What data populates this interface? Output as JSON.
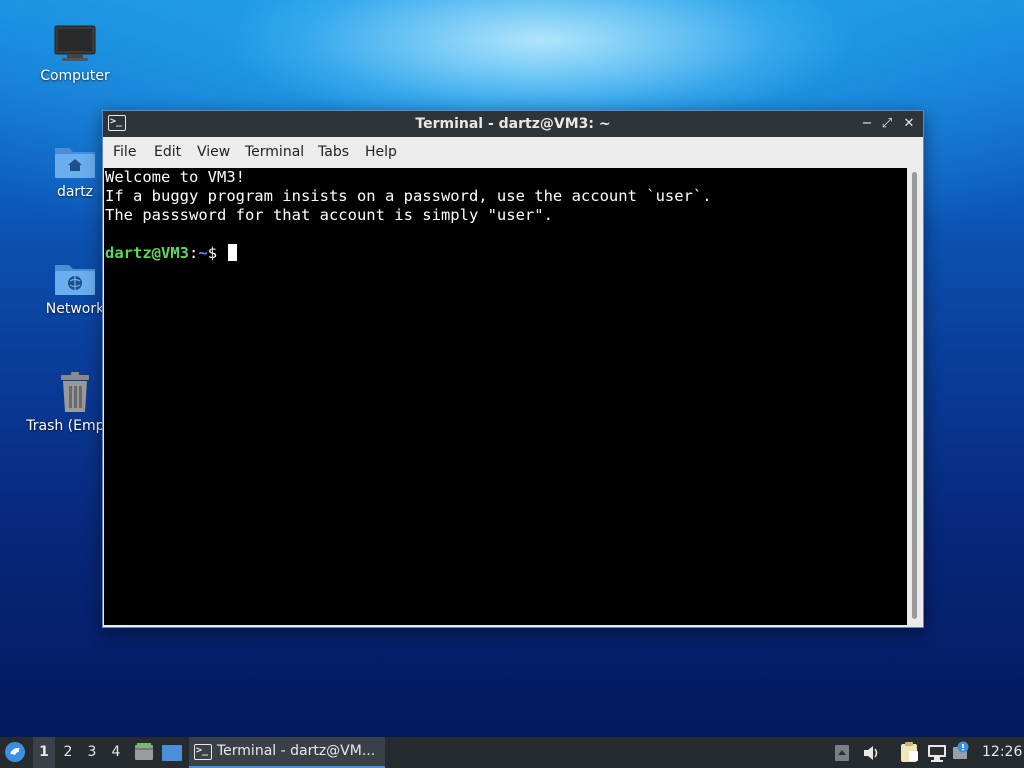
{
  "desktop": {
    "icons": [
      {
        "label": "Computer",
        "icon": "computer-icon"
      },
      {
        "label": "dartz",
        "icon": "home-folder-icon"
      },
      {
        "label": "Network",
        "icon": "network-folder-icon"
      },
      {
        "label": "Trash (Empty)",
        "icon": "trash-icon"
      }
    ]
  },
  "window": {
    "title": "Terminal - dartz@VM3: ~",
    "app_icon_glyph": ">_",
    "controls": {
      "minimize": "−",
      "maximize": "⤢",
      "close": "✕"
    },
    "menu": [
      "File",
      "Edit",
      "View",
      "Terminal",
      "Tabs",
      "Help"
    ]
  },
  "terminal": {
    "lines": [
      "Welcome to VM3!",
      "If a buggy program insists on a password, use the account `user`.",
      "The passsword for that account is simply \"user\"."
    ],
    "prompt": {
      "user_host": "dartz@VM3",
      "separator": ":",
      "path": "~",
      "symbol": "$ "
    },
    "colors": {
      "background": "#000000",
      "text": "#ffffff",
      "prompt_user": "#5fd75f",
      "prompt_path": "#5f87ff"
    }
  },
  "taskbar": {
    "workspaces": [
      "1",
      "2",
      "3",
      "4"
    ],
    "active_workspace": "1",
    "task_label": "Terminal - dartz@VM...",
    "clock": "12:26",
    "colors": {
      "background": "#262b30",
      "accent": "#4a90d9"
    }
  }
}
